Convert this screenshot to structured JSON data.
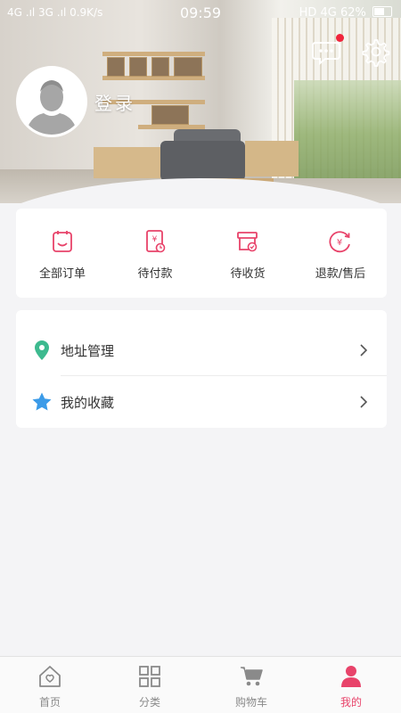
{
  "status_bar": {
    "left": "4G .ıl 3G .ıl 0.9K/s",
    "time": "09:59",
    "right": "HD 4G 62%"
  },
  "profile": {
    "login_label": "登录"
  },
  "orders": [
    {
      "label": "全部订单",
      "icon": "order-list-icon"
    },
    {
      "label": "待付款",
      "icon": "pending-payment-icon"
    },
    {
      "label": "待收货",
      "icon": "pending-receipt-icon"
    },
    {
      "label": "退款/售后",
      "icon": "refund-icon"
    }
  ],
  "menu": [
    {
      "label": "地址管理",
      "icon": "location-pin-icon"
    },
    {
      "label": "我的收藏",
      "icon": "star-icon"
    }
  ],
  "bottom_nav": [
    {
      "label": "首页",
      "icon": "home-icon",
      "active": false
    },
    {
      "label": "分类",
      "icon": "grid-icon",
      "active": false
    },
    {
      "label": "购物车",
      "icon": "cart-icon",
      "active": false
    },
    {
      "label": "我的",
      "icon": "person-icon",
      "active": true
    }
  ],
  "colors": {
    "accent": "#e8436a",
    "location_icon": "#3dba8f",
    "star_icon": "#3b9be8",
    "badge": "#f0243c"
  }
}
